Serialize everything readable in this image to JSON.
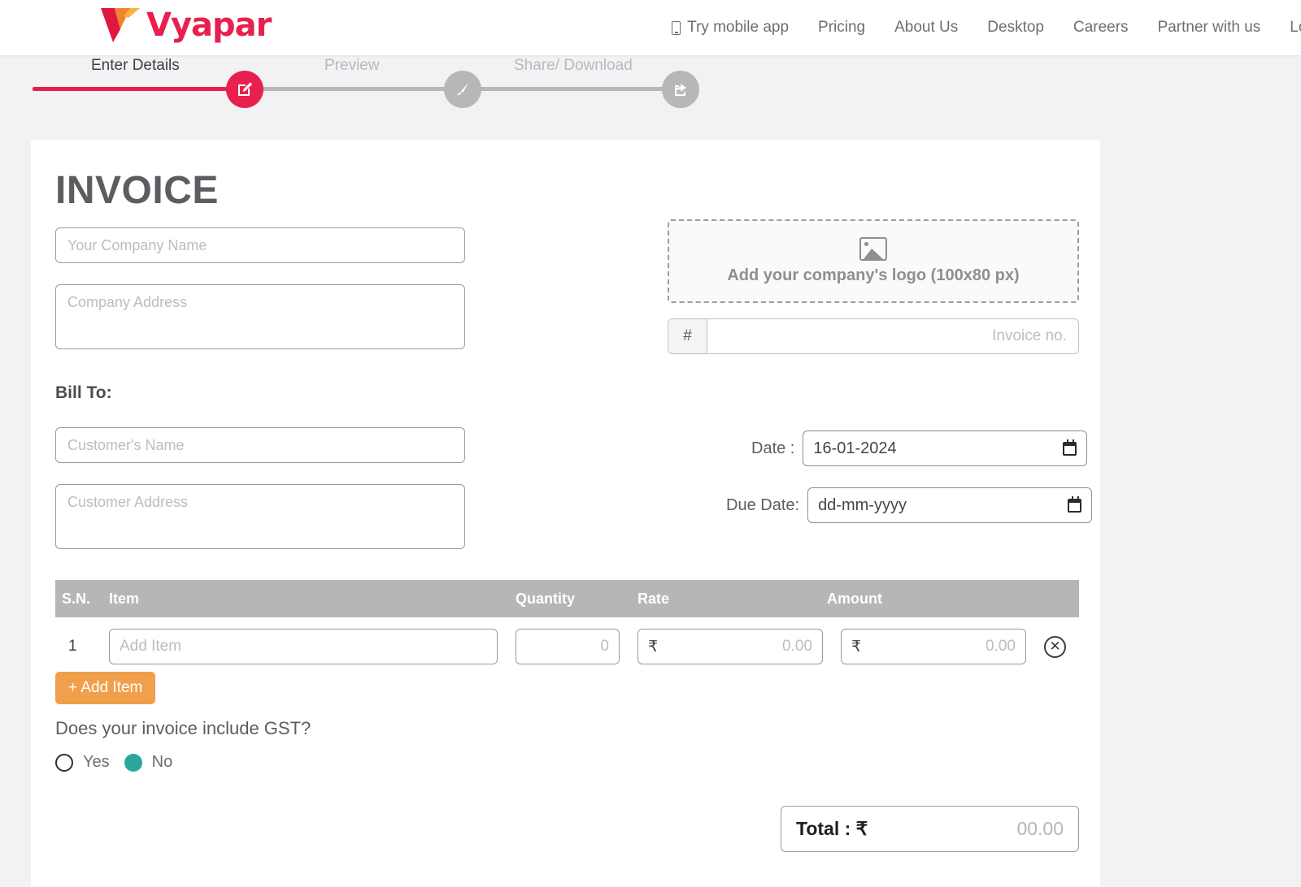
{
  "nav": {
    "brand": "Vyapar",
    "links": [
      {
        "label": "Try mobile app",
        "icon": "mobile-phone-icon"
      },
      {
        "label": "Pricing",
        "icon": ""
      },
      {
        "label": "About Us",
        "icon": ""
      },
      {
        "label": "Desktop",
        "icon": ""
      },
      {
        "label": "Careers",
        "icon": ""
      },
      {
        "label": "Partner with us",
        "icon": ""
      },
      {
        "label": "Log",
        "icon": ""
      }
    ]
  },
  "stepper": {
    "steps": [
      {
        "label": "Enter Details",
        "state": "active",
        "icon": "edit-pencil-square-icon"
      },
      {
        "label": "Preview",
        "state": "inactive",
        "icon": "paintbrush-icon"
      },
      {
        "label": "Share/ Download",
        "state": "inactive",
        "icon": "share-icon"
      }
    ],
    "active_color": "#e8204e",
    "inactive_color": "#b7b7b7"
  },
  "invoice": {
    "title": "INVOICE",
    "company_name_placeholder": "Your Company Name",
    "company_name_value": "",
    "company_address_placeholder": "Company Address",
    "company_address_value": "",
    "bill_to_label": "Bill To:",
    "customer_name_placeholder": "Customer's Name",
    "customer_name_value": "",
    "customer_address_placeholder": "Customer Address",
    "customer_address_value": "",
    "logo_upload_text": "Add your company's logo (100x80 px)",
    "invoice_no_prefix": "#",
    "invoice_no_placeholder": "Invoice no.",
    "invoice_no_value": "",
    "date_label": "Date :",
    "date_value": "16-01-2024",
    "due_date_label": "Due Date:",
    "due_date_value": "dd-mm-yyyy"
  },
  "items_table": {
    "columns": [
      "S.N.",
      "Item",
      "Quantity",
      "Rate",
      "Amount"
    ],
    "rows": [
      {
        "sn": "1",
        "item_placeholder": "Add Item",
        "item_value": "",
        "quantity_placeholder": "0",
        "quantity_value": "",
        "rate_currency": "₹",
        "rate_placeholder": "0.00",
        "rate_value": "",
        "amount_currency": "₹",
        "amount_placeholder": "0.00",
        "amount_value": "",
        "delete_icon": "circle-x-icon"
      }
    ],
    "add_item_label": "+ Add Item",
    "add_item_color": "#f0a04b"
  },
  "gst": {
    "question": "Does your invoice include GST?",
    "options": [
      {
        "label": "Yes",
        "selected": false
      },
      {
        "label": "No",
        "selected": true
      }
    ],
    "selected_color": "#2aa79b"
  },
  "total": {
    "label": "Total :  ₹",
    "value": "00.00"
  }
}
